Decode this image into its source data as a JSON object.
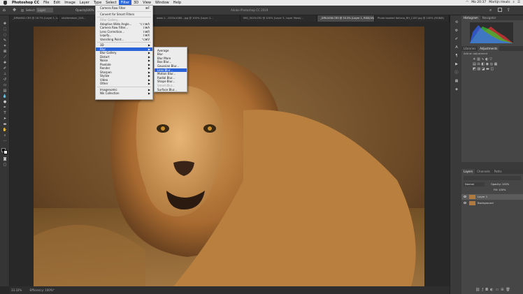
{
  "menubar": {
    "app_name": "Photoshop CC",
    "items": [
      "File",
      "Edit",
      "Image",
      "Layer",
      "Type",
      "Select",
      "Filter",
      "3D",
      "View",
      "Window",
      "Help"
    ],
    "active_item": "Filter",
    "clock": "Mo 20:37",
    "user": "Martijn Heuts"
  },
  "window_title": "Adobe Photoshop CC 2019",
  "options_bar": {
    "select_label": "Select:",
    "select_value": "Layer",
    "opacity_label": "Opacity:",
    "opacity_value": "100%"
  },
  "tabs": [
    "_DPA0462.CR3 @ 16.7% (Layer 1, Layer Mask/8...",
    "shutterstock_243...",
    "...",
    "www-1...1520x1080...jpg @ 100% (Layer 2...",
    "IMG_5029.CR2 @ 100% (Layer 3, Layer Mask/...",
    "_DPA1456.CR3 @ 33.3% (Layer 1, RGB/16)",
    "Photo booked Italiano_RH_1187.jpg @ 100% (RGB/8)"
  ],
  "active_tab_index": 5,
  "filter_menu": {
    "items": [
      {
        "label": "Camera Raw Filter",
        "shortcut": "⌘F",
        "type": "item"
      },
      {
        "type": "sep"
      },
      {
        "label": "Convert for Smart Filters",
        "type": "item"
      },
      {
        "type": "sep"
      },
      {
        "label": "Filter Gallery...",
        "type": "disabled"
      },
      {
        "label": "Adaptive Wide Angle...",
        "shortcut": "⌥⇧⌘A",
        "type": "item"
      },
      {
        "label": "Camera Raw Filter...",
        "shortcut": "⇧⌘A",
        "type": "item"
      },
      {
        "label": "Lens Correction...",
        "shortcut": "⇧⌘R",
        "type": "item"
      },
      {
        "label": "Liquify...",
        "shortcut": "⇧⌘X",
        "type": "item"
      },
      {
        "label": "Vanishing Point...",
        "shortcut": "⌥⌘V",
        "type": "item"
      },
      {
        "type": "sep"
      },
      {
        "label": "3D",
        "type": "sub"
      },
      {
        "label": "Blur",
        "type": "sub",
        "highlight": true
      },
      {
        "label": "Blur Gallery",
        "type": "sub"
      },
      {
        "label": "Distort",
        "type": "sub"
      },
      {
        "label": "Noise",
        "type": "sub"
      },
      {
        "label": "Pixelate",
        "type": "sub"
      },
      {
        "label": "Render",
        "type": "sub"
      },
      {
        "label": "Sharpen",
        "type": "sub"
      },
      {
        "label": "Stylize",
        "type": "sub"
      },
      {
        "label": "Video",
        "type": "sub"
      },
      {
        "label": "Other",
        "type": "sub"
      },
      {
        "type": "sep"
      },
      {
        "label": "Imagenomic",
        "type": "sub"
      },
      {
        "label": "Nik Collection",
        "type": "sub"
      }
    ]
  },
  "blur_menu": {
    "items": [
      {
        "label": "Average",
        "type": "item"
      },
      {
        "label": "Blur",
        "type": "item"
      },
      {
        "label": "Blur More",
        "type": "item"
      },
      {
        "label": "Box Blur...",
        "type": "item"
      },
      {
        "label": "Gaussian Blur...",
        "type": "item"
      },
      {
        "label": "Lens Blur...",
        "type": "item",
        "highlight": true
      },
      {
        "label": "Motion Blur...",
        "type": "item"
      },
      {
        "label": "Radial Blur...",
        "type": "item"
      },
      {
        "label": "Shape Blur...",
        "type": "item"
      },
      {
        "label": "Smart Blur...",
        "type": "disabled"
      },
      {
        "label": "Surface Blur...",
        "type": "item"
      }
    ]
  },
  "panels": {
    "histogram_tabs": [
      "Histogram",
      "Navigator"
    ],
    "adjust_tabs": [
      "Libraries",
      "Adjustments"
    ],
    "adjust_hint": "Add an adjustment",
    "layers_tabs": [
      "Layers",
      "Channels",
      "Paths"
    ],
    "blend_mode": "Normal",
    "opacity": "Opacity: 100%",
    "fill": "Fill: 100%",
    "layers": [
      {
        "name": "Layer 1",
        "selected": true
      },
      {
        "name": "Background",
        "selected": false
      }
    ]
  },
  "status_bar": {
    "zoom": "33.33%",
    "doc": "Efficiency: 100%*"
  },
  "colors": {
    "accent": "#2a64d8",
    "panel": "#464646",
    "menu_bg": "#ececec"
  }
}
